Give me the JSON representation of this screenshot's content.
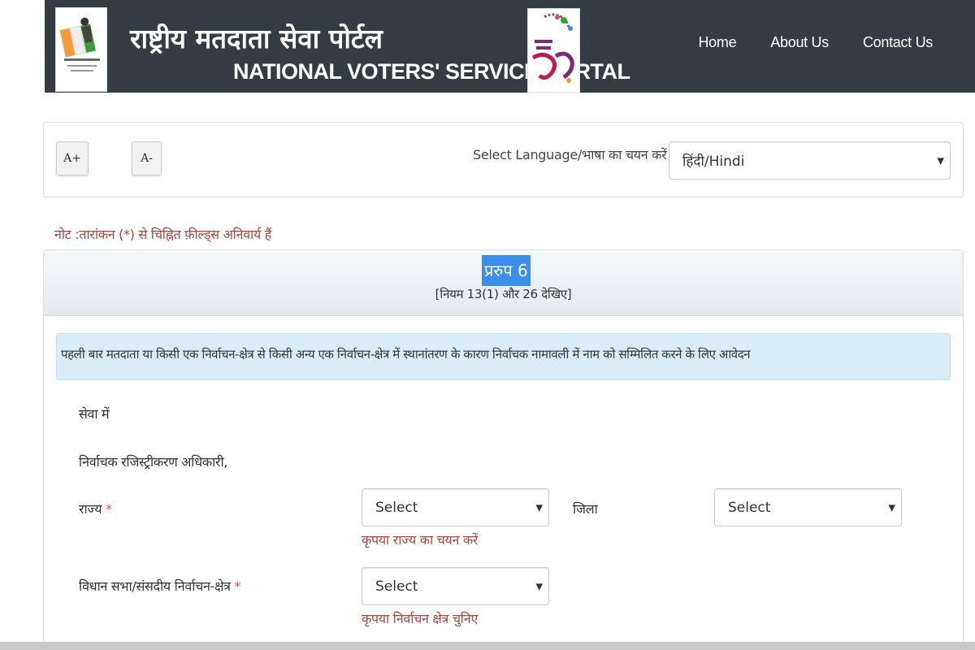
{
  "header": {
    "title_hindi": "राष्ट्रीय मतदाता सेवा पोर्टल",
    "title_english": "NATIONAL VOTERS' SERVICE PORTAL",
    "eci_logo_icon": "eci-logo-icon",
    "mahotsav_logo_icon": "desh-ka-maha-tyohar-logo-icon",
    "nav": [
      {
        "label": "Home"
      },
      {
        "label": "About Us"
      },
      {
        "label": "Contact Us"
      }
    ]
  },
  "tools": {
    "font_increase": "A+",
    "font_decrease": "A-",
    "language_label": "Select Language/भाषा का चयन करें",
    "language_value": "हिंदी/Hindi"
  },
  "note": "नोट :तारांकन (*) से चिह्नित फ़ील्ड्स अनिवार्य हैं",
  "form": {
    "title": "प्ररुप 6",
    "subtitle": "[नियम 13(1) और 26 देखिए]",
    "description": "पहली बार मतदाता या किसी एक निर्वाचन-क्षेत्र से किसी अन्य एक निर्वाचन-क्षेत्र में स्थानांतरण के कारण निर्वाचक नामावली में नाम को सम्मिलित करने के लिए आवेदन",
    "salutation": "सेवा में",
    "addressee": "निर्वाचक रजिस्ट्रीकरण अधिकारी,",
    "state": {
      "label": "राज्य",
      "required_mark": "*",
      "value": "Select",
      "error": "कृपया राज्य का चयन करें"
    },
    "district": {
      "label": "जिला",
      "value": "Select"
    },
    "constituency": {
      "label": "विधान सभा/संसदीय निर्वाचन-क्षेत्र",
      "required_mark": "*",
      "value": "Select",
      "error": "कृपया निर्वाचन क्षेत्र चुनिए"
    }
  },
  "colors": {
    "header_bg": "#353b42",
    "error_text": "#a94442",
    "info_bg": "#d9edf7",
    "highlight": "#3b8fe8"
  }
}
